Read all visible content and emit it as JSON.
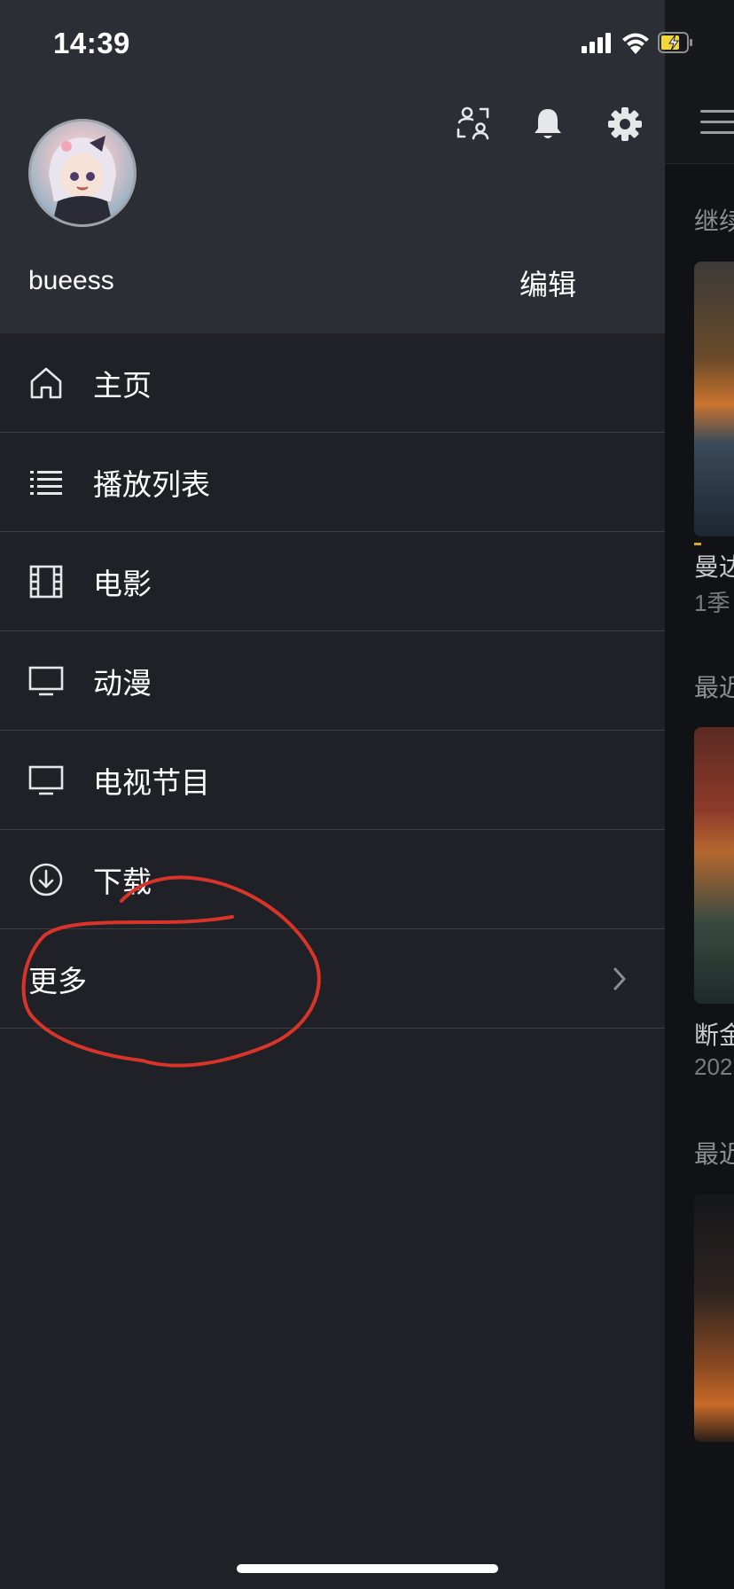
{
  "status_bar": {
    "time": "14:39"
  },
  "profile": {
    "username": "bueess",
    "edit_label": "编辑"
  },
  "header_icons": [
    "users-icon",
    "bell-icon",
    "gear-icon"
  ],
  "menu": {
    "items": [
      {
        "label": "主页",
        "icon": "home-icon"
      },
      {
        "label": "播放列表",
        "icon": "list-icon"
      },
      {
        "label": "电影",
        "icon": "film-icon"
      },
      {
        "label": "动漫",
        "icon": "tv-icon"
      },
      {
        "label": "电视节目",
        "icon": "tv-icon"
      },
      {
        "label": "下载",
        "icon": "download-icon"
      }
    ],
    "more_label": "更多"
  },
  "background_screen": {
    "section1": "继续",
    "item1_title": "曼达",
    "item1_sub": "1季",
    "section2": "最近",
    "item2_title": "断金",
    "item2_sub": "202",
    "section3": "最近"
  },
  "colors": {
    "drawer_bg": "#1f2127",
    "header_bg": "#2b2e35",
    "annotation": "#d8342a",
    "battery_charge": "#f2d73a"
  }
}
